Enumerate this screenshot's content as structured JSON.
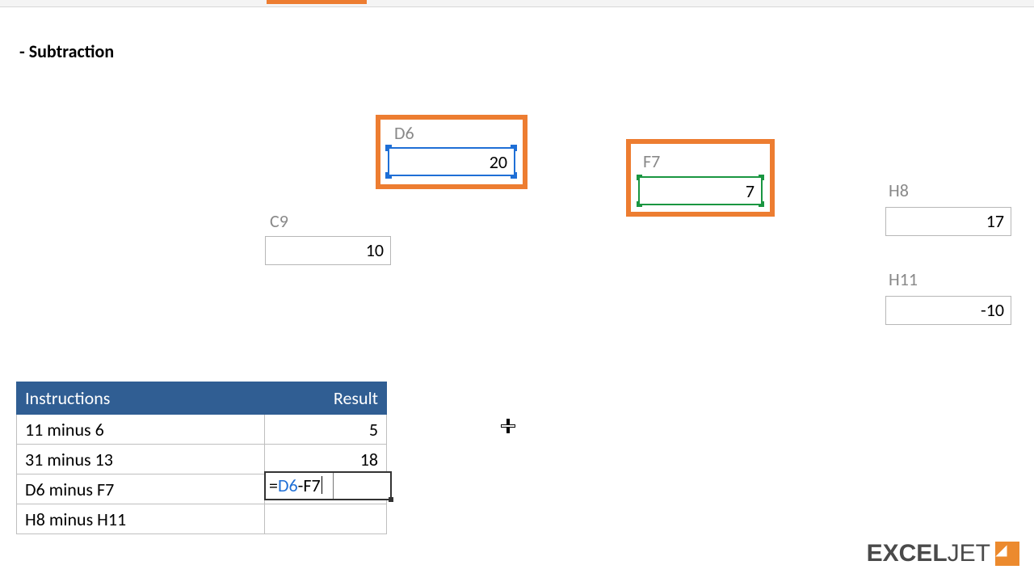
{
  "title": "- Subtraction",
  "cells": {
    "D6": {
      "label": "D6",
      "value": "20"
    },
    "F7": {
      "label": "F7",
      "value": "7"
    },
    "C9": {
      "label": "C9",
      "value": "10"
    },
    "H8": {
      "label": "H8",
      "value": "17"
    },
    "H11": {
      "label": "H11",
      "value": "-10"
    }
  },
  "table": {
    "headers": {
      "instructions": "Instructions",
      "result": "Result"
    },
    "rows": [
      {
        "instr": "11 minus 6",
        "result": "5"
      },
      {
        "instr": "31 minus 13",
        "result": "18"
      },
      {
        "instr": "D6 minus F7",
        "result": ""
      },
      {
        "instr": "H8 minus H11",
        "result": ""
      }
    ]
  },
  "formula_edit": {
    "eq": "=",
    "ref1": "D6",
    "op": "-",
    "ref2": "F7",
    "full": "=D6-F7"
  },
  "logo": {
    "part1": "EXCEL",
    "part2": "JET"
  }
}
